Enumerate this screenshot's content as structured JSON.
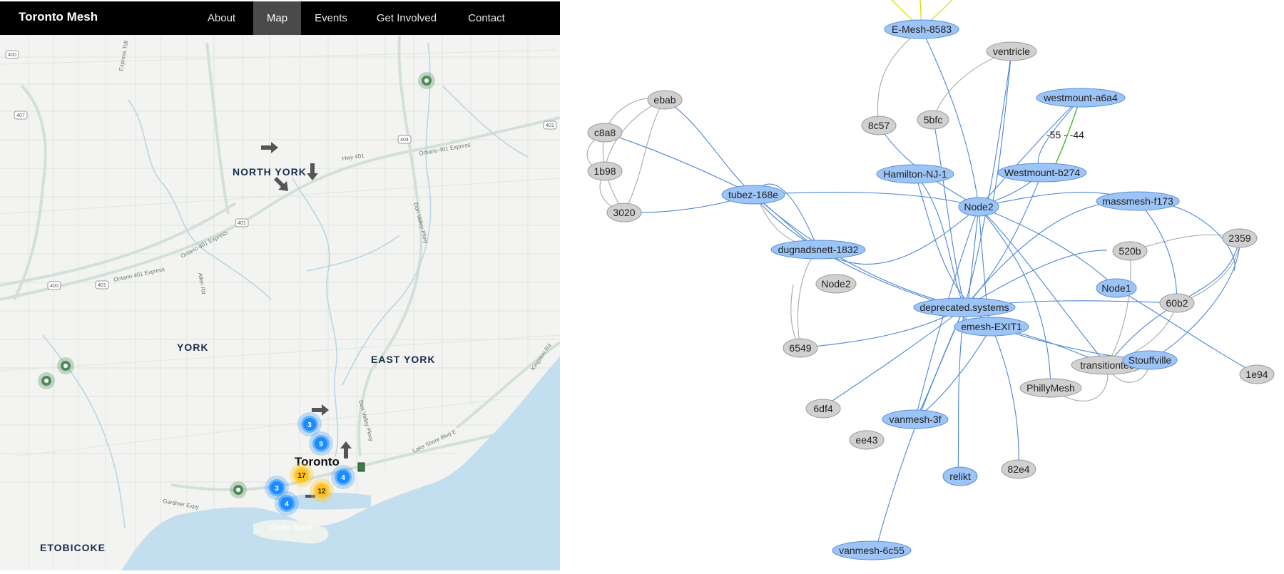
{
  "header": {
    "brand": "Toronto Mesh",
    "nav": [
      {
        "label": "About",
        "active": false
      },
      {
        "label": "Map",
        "active": true
      },
      {
        "label": "Events",
        "active": false
      },
      {
        "label": "Get Involved",
        "active": false
      },
      {
        "label": "Contact",
        "active": false
      }
    ]
  },
  "map": {
    "areas": [
      "NORTH YORK",
      "YORK",
      "EAST YORK",
      "ETOBICOKE"
    ],
    "city_label": "Toronto",
    "island_label": "Centre Island",
    "highway_shields": [
      "400",
      "407",
      "401",
      "404",
      "401",
      "401",
      "400",
      "401"
    ],
    "road_labels": [
      "Hwy 401",
      "Ontario 401 Express",
      "Ontario 401 Express",
      "Ontario 401 Express",
      "Express Toll",
      "Allen Rd",
      "Don Valley Pkwy",
      "Don Valley Pkwy",
      "Lake Shore Blvd E",
      "Gardiner Expy",
      "Kingston Rd"
    ],
    "clusters": [
      {
        "count": "3",
        "status": "active"
      },
      {
        "count": "9",
        "status": "active"
      },
      {
        "count": "17",
        "status": "potential"
      },
      {
        "count": "4",
        "status": "active"
      },
      {
        "count": "3",
        "status": "active"
      },
      {
        "count": "12",
        "status": "potential"
      },
      {
        "count": "4",
        "status": "active"
      }
    ],
    "colors": {
      "water": "#c3dfef",
      "land": "#f3f4f1",
      "road": "#d9e4df",
      "river": "#b7d3e6",
      "active": "#1a8cff",
      "potential": "#ffc21a",
      "site": "#4e8a5a",
      "label": "#1a2b4c"
    }
  },
  "graph": {
    "colors": {
      "node_blue": "#9cc4f6",
      "node_blue_stroke": "#5b8fd6",
      "node_gray": "#d0d0d0",
      "node_gray_stroke": "#9a9a9a",
      "edge_blue": "#4a86d8",
      "edge_gray": "#a8a8a8",
      "edge_green": "#3dbb2b",
      "edge_yellow": "#d8d800"
    },
    "edge_label": "-55 - -44",
    "nodes": {
      "emesh8583": "E-Mesh-8583",
      "ventricle": "ventricle",
      "westmount_a6a4": "westmount-a6a4",
      "ebab": "ebab",
      "c8a8": "c8a8",
      "n8c57": "8c57",
      "n5bfc": "5bfc",
      "hamilton": "Hamilton-NJ-1",
      "westmount_b274": "Westmount-b274",
      "n1b98": "1b98",
      "tubez": "tubez-168e",
      "node2_top": "Node2",
      "massmesh": "massmesh-f173",
      "n3020": "3020",
      "n2359": "2359",
      "dugnad": "dugnadsnett-1832",
      "n520b": "520b",
      "node2_gray": "Node2",
      "node1": "Node1",
      "deprecated": "deprecated.systems",
      "n60b2": "60b2",
      "emesh_exit1": "emesh-EXIT1",
      "n6549": "6549",
      "transition": "transitiontec",
      "stouffville": "Stouffville",
      "n1e94": "1e94",
      "phillymesh": "PhillyMesh",
      "n6df4": "6df4",
      "vanmesh3f": "vanmesh-3f",
      "ee43": "ee43",
      "relikt": "relikt",
      "n82e4": "82e4",
      "vanmesh6c55": "vanmesh-6c55"
    }
  }
}
